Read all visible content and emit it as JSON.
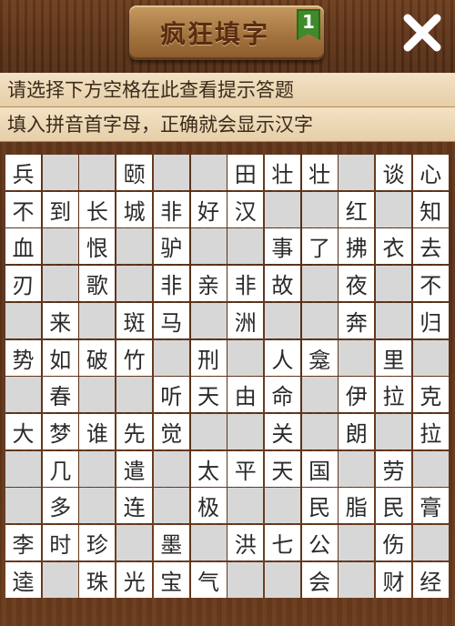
{
  "header": {
    "title": "疯狂填字",
    "level": "1",
    "close_icon": "close-x-icon"
  },
  "hints": {
    "line1": "请选择下方空格在此查看提示答题",
    "line2": "填入拼音首字母，正确就会显示汉字"
  },
  "colors": {
    "wood": "#5a3118",
    "hint_bg": "#f0dfc0",
    "cell_filled": "#ffffff",
    "cell_blank": "#d7d7d7",
    "badge": "#3f8a2a"
  },
  "grid": [
    [
      "兵",
      "#",
      "#",
      "颐",
      "",
      "",
      "田",
      "壮",
      "壮",
      "",
      "谈",
      "心"
    ],
    [
      "不",
      "到",
      "长",
      "城",
      "非",
      "好",
      "汉",
      "",
      "",
      "红",
      "",
      "知"
    ],
    [
      "血",
      "",
      "恨",
      "",
      "驴",
      "",
      "",
      "事",
      "了",
      "拂",
      "衣",
      "去"
    ],
    [
      "刃",
      "",
      "歌",
      "",
      "非",
      "亲",
      "非",
      "故",
      "",
      "夜",
      "",
      "不"
    ],
    [
      "",
      "来",
      "",
      "斑",
      "马",
      "",
      "洲",
      "",
      "",
      "奔",
      "",
      "归"
    ],
    [
      "势",
      "如",
      "破",
      "竹",
      "",
      "刑",
      "",
      "人",
      "龛",
      "",
      "里",
      ""
    ],
    [
      "",
      "春",
      "",
      "",
      "听",
      "天",
      "由",
      "命",
      "",
      "伊",
      "拉",
      "克"
    ],
    [
      "大",
      "梦",
      "谁",
      "先",
      "觉",
      "",
      "",
      "关",
      "",
      "朗",
      "",
      "拉"
    ],
    [
      "",
      "几",
      "",
      "遣",
      "",
      "太",
      "平",
      "天",
      "国",
      "",
      "劳",
      ""
    ],
    [
      "",
      "多",
      "",
      "连",
      "",
      "极",
      "",
      "",
      "民",
      "脂",
      "民",
      "膏"
    ],
    [
      "李",
      "时",
      "珍",
      "",
      "墨",
      "",
      "洪",
      "七",
      "公",
      "",
      "伤",
      ""
    ],
    [
      "逵",
      "",
      "珠",
      "光",
      "宝",
      "气",
      "",
      "",
      "会",
      "",
      "财",
      "经"
    ]
  ]
}
